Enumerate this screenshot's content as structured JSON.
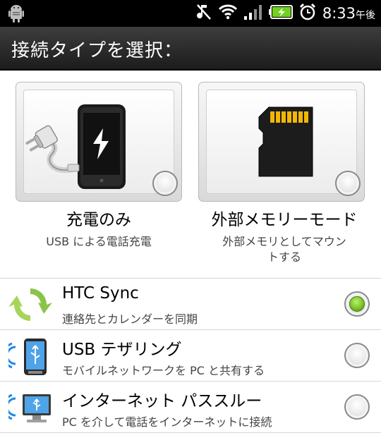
{
  "status_bar": {
    "time": "8:33",
    "ampm": "午後",
    "icons": [
      "android-debug-icon",
      "mute-icon",
      "wifi-icon",
      "signal-icon",
      "battery-charging-icon",
      "alarm-icon"
    ]
  },
  "header": {
    "title": "接続タイプを選択："
  },
  "tiles": [
    {
      "label": "充電のみ",
      "subtitle": "USB による電話充電",
      "icon": "phone-charging-icon",
      "selected": false
    },
    {
      "label": "外部メモリーモード",
      "subtitle": "外部メモリとしてマウントする",
      "subtitle_line1": "外部メモリとしてマウン",
      "subtitle_line2": "トする",
      "icon": "sd-card-icon",
      "selected": false
    }
  ],
  "options": [
    {
      "title": "HTC Sync",
      "subtitle": "連絡先とカレンダーを同期",
      "icon": "sync-arrows-icon",
      "selected": true
    },
    {
      "title": "USB テザリング",
      "subtitle": "モバイルネットワークを PC と共有する",
      "icon": "usb-tethering-icon",
      "selected": false
    },
    {
      "title": "インターネット パススルー",
      "subtitle": "PC を介して電話をインターネットに接続",
      "icon": "internet-passthrough-icon",
      "selected": false
    }
  ],
  "colors": {
    "status_bar_bg": "#000000",
    "title_bar_bg": "#2a2a2a",
    "battery_green": "#6fd21c",
    "selected_green": "#7cc22b"
  }
}
